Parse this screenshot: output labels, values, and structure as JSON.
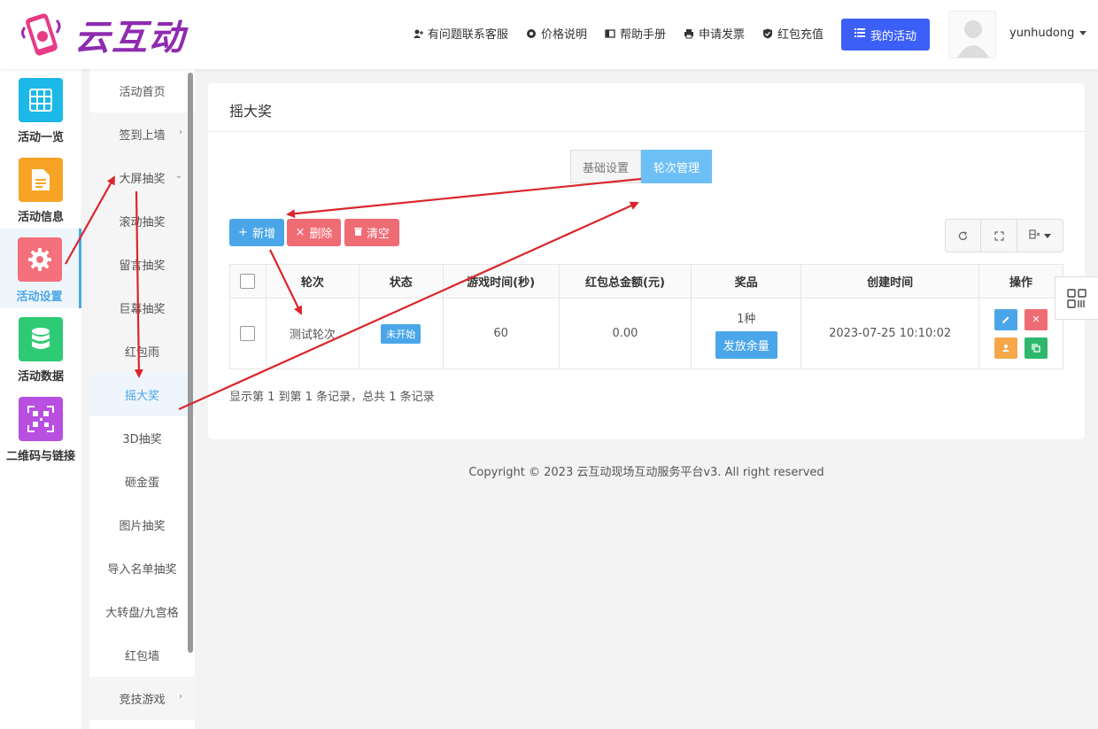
{
  "brand": {
    "name": "云互动"
  },
  "topnav": {
    "items": [
      {
        "label": "有问题联系客服",
        "icon": "user-plus-icon"
      },
      {
        "label": "价格说明",
        "icon": "gear-icon"
      },
      {
        "label": "帮助手册",
        "icon": "book-icon"
      },
      {
        "label": "申请发票",
        "icon": "printer-icon"
      },
      {
        "label": "红包充值",
        "icon": "shield-check-icon"
      }
    ],
    "my_activity": "我的活动",
    "username": "yunhudong"
  },
  "icon_nav": [
    {
      "label": "活动一览",
      "color": "#1bb8e8"
    },
    {
      "label": "活动信息",
      "color": "#f7a325"
    },
    {
      "label": "活动设置",
      "color": "#f4707c",
      "active": true
    },
    {
      "label": "活动数据",
      "color": "#2ecb74"
    },
    {
      "label": "二维码与链接",
      "color": "#b84fe0"
    }
  ],
  "sub_nav": [
    {
      "label": "活动首页"
    },
    {
      "label": "签到上墙",
      "arrow": "›"
    },
    {
      "label": "大屏抽奖",
      "arrow": "⌄"
    },
    {
      "label": "滚动抽奖"
    },
    {
      "label": "留言抽奖"
    },
    {
      "label": "巨幕抽奖"
    },
    {
      "label": "红包雨"
    },
    {
      "label": "摇大奖",
      "active": true
    },
    {
      "label": "3D抽奖"
    },
    {
      "label": "砸金蛋"
    },
    {
      "label": "图片抽奖"
    },
    {
      "label": "导入名单抽奖"
    },
    {
      "label": "大转盘/九宫格"
    },
    {
      "label": "红包墙"
    },
    {
      "label": "竞技游戏",
      "arrow": "›"
    }
  ],
  "panel": {
    "title": "摇大奖",
    "tabs": [
      "基础设置",
      "轮次管理"
    ],
    "buttons": {
      "add": "新增",
      "delete": "删除",
      "clear": "清空"
    },
    "table": {
      "headers": [
        "轮次",
        "状态",
        "游戏时间(秒)",
        "红包总金额(元)",
        "奖品",
        "创建时间",
        "操作"
      ],
      "rows": [
        {
          "round": "测试轮次",
          "status": "未开始",
          "game_time": "60",
          "red_packet_total": "0.00",
          "prize_count": "1种",
          "prize_button": "发放余量",
          "created": "2023-07-25 10:10:02"
        }
      ]
    },
    "records": "显示第 1 到第 1 条记录，总共 1 条记录"
  },
  "footer": "Copyright © 2023 云互动现场互动服务平台v3. All right reserved",
  "colors": {
    "primary": "#4aa6e8",
    "danger": "#ef6c75",
    "brand_blue": "#3b5ff7",
    "annotation_red": "#d9262c"
  }
}
